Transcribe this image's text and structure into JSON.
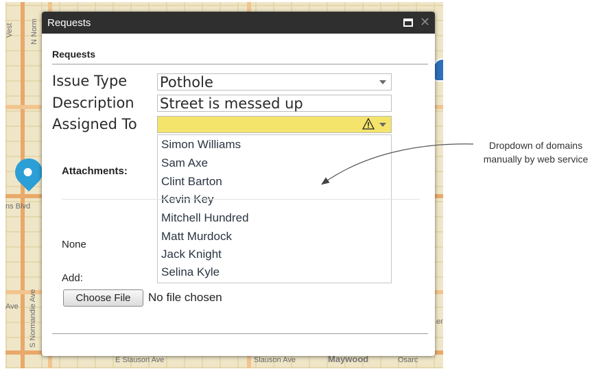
{
  "map": {
    "labels": {
      "street_top_left": "N Norm",
      "street_left": "Vest",
      "street_blvd": "ns Blvd",
      "street_normandie": "S Normandie Ave",
      "street_ave": "Ave",
      "street_slauson_1": "E Slauson Ave",
      "street_slauson_2": "Slauson Ave",
      "place_maywood": "Maywood",
      "place_right": "Osarc",
      "edge_right": "er"
    }
  },
  "dialog": {
    "title": "Requests",
    "section_title": "Requests",
    "fields": {
      "issue_type": {
        "label": "Issue Type",
        "value": "Pothole"
      },
      "description": {
        "label": "Description",
        "value": "Street is messed up"
      },
      "assigned_to": {
        "label": "Assigned To",
        "value": ""
      }
    },
    "dropdown_options": [
      "Simon Williams",
      "Sam Axe",
      "Clint Barton",
      "Kevin Key",
      "Mitchell Hundred",
      "Matt Murdock",
      "Jack Knight",
      "Selina Kyle"
    ],
    "attachments_label": "Attachments:",
    "none_label": "None",
    "add_label": "Add:",
    "choose_file_label": "Choose File",
    "file_status": "No file chosen"
  },
  "annotation": {
    "line1": "Dropdown of domains",
    "line2": "manually by web service"
  },
  "colors": {
    "titlebar": "#2f2f2f",
    "warning_field": "#f4e46b",
    "pin": "#2b9fd6",
    "map_base": "#efe6c8"
  }
}
